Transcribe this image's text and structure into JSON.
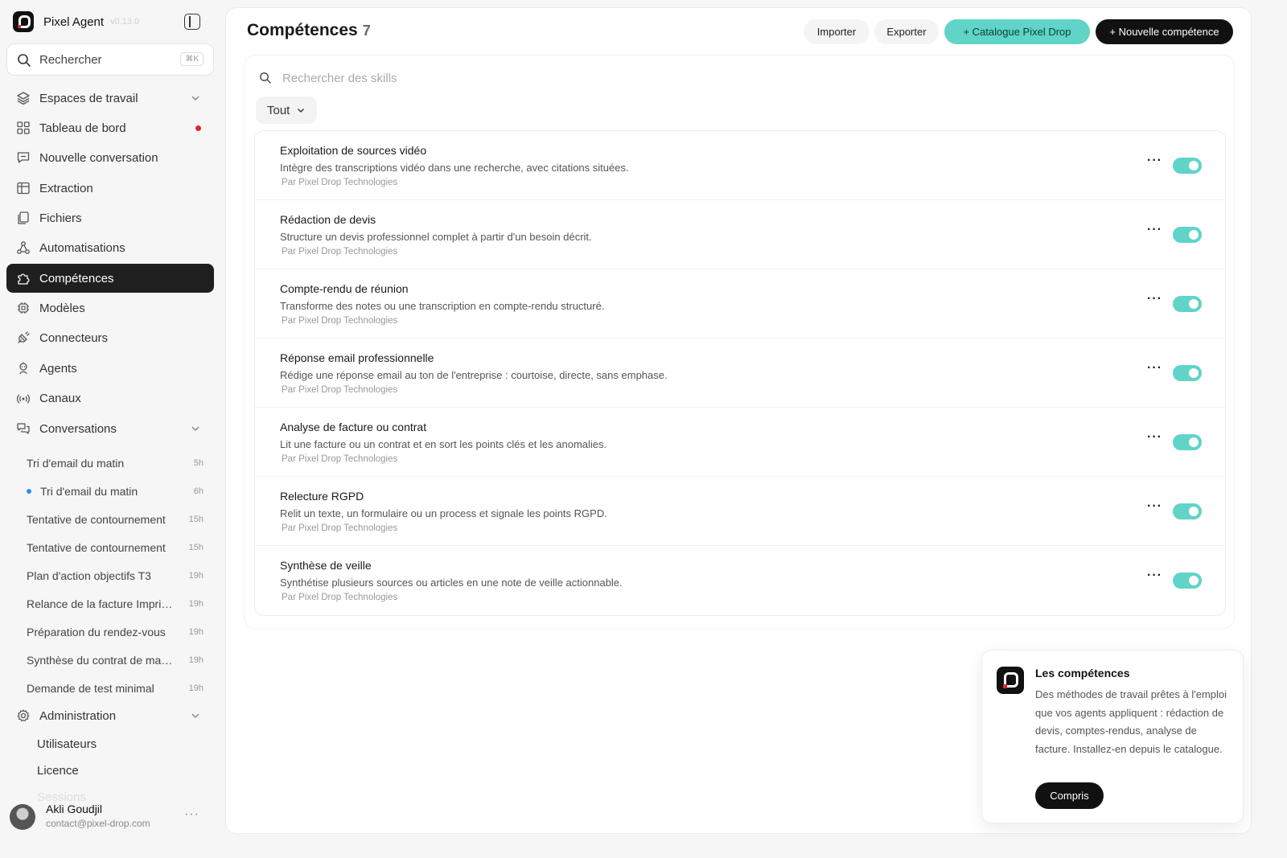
{
  "app": {
    "name": "Pixel Agent",
    "version": "v0.13.0"
  },
  "search": {
    "label": "Rechercher",
    "shortcut": "⌘K"
  },
  "nav": [
    {
      "id": "workspaces",
      "label": "Espaces de travail",
      "icon": "layers-icon"
    },
    {
      "id": "dashboard",
      "label": "Tableau de bord",
      "icon": "grid-icon"
    },
    {
      "id": "new-conversation",
      "label": "Nouvelle conversation",
      "icon": "message-plus-icon"
    },
    {
      "id": "extraction",
      "label": "Extraction",
      "icon": "table-icon"
    },
    {
      "id": "files",
      "label": "Fichiers",
      "icon": "files-icon"
    },
    {
      "id": "automations",
      "label": "Automatisations",
      "icon": "workflow-icon"
    },
    {
      "id": "skills",
      "label": "Compétences",
      "icon": "puzzle-icon",
      "active": true
    },
    {
      "id": "models",
      "label": "Modèles",
      "icon": "chip-icon"
    },
    {
      "id": "connectors",
      "label": "Connecteurs",
      "icon": "plug-icon"
    },
    {
      "id": "agents",
      "label": "Agents",
      "icon": "bot-icon"
    },
    {
      "id": "channels",
      "label": "Canaux",
      "icon": "radio-icon"
    },
    {
      "id": "conversations",
      "label": "Conversations",
      "icon": "chats-icon"
    }
  ],
  "conversations": [
    {
      "title": "Tri d'email du matin",
      "time": "5h"
    },
    {
      "title": "Tri d'email du matin",
      "time": "6h",
      "unread": true
    },
    {
      "title": "Tentative de contournement",
      "time": "15h"
    },
    {
      "title": "Tentative de contournement",
      "time": "15h"
    },
    {
      "title": "Plan d'action objectifs T3",
      "time": "19h"
    },
    {
      "title": "Relance de la facture Imprimerie",
      "time": "19h"
    },
    {
      "title": "Préparation du rendez-vous",
      "time": "19h"
    },
    {
      "title": "Synthèse du contrat de maintenance",
      "time": "19h"
    },
    {
      "title": "Demande de test minimal",
      "time": "19h"
    }
  ],
  "admin": {
    "label": "Administration",
    "items": [
      "Utilisateurs",
      "Licence",
      "Sessions"
    ]
  },
  "user": {
    "name": "Akli Goudjil",
    "email": "contact@pixel-drop.com"
  },
  "page": {
    "title": "Compétences",
    "count": "7",
    "actions": {
      "import": "Importer",
      "export": "Exporter",
      "catalog": "+ Catalogue Pixel Drop",
      "new": "+ Nouvelle compétence"
    },
    "search_placeholder": "Rechercher des skills",
    "filter": "Tout"
  },
  "skills": [
    {
      "name": "Exploitation de sources vidéo",
      "description": "Intègre des transcriptions vidéo dans une recherche, avec citations situées.",
      "author": "Par Pixel Drop Technologies",
      "enabled": true
    },
    {
      "name": "Rédaction de devis",
      "description": "Structure un devis professionnel complet à partir d'un besoin décrit.",
      "author": "Par Pixel Drop Technologies",
      "enabled": true
    },
    {
      "name": "Compte-rendu de réunion",
      "description": "Transforme des notes ou une transcription en compte-rendu structuré.",
      "author": "Par Pixel Drop Technologies",
      "enabled": true
    },
    {
      "name": "Réponse email professionnelle",
      "description": "Rédige une réponse email au ton de l'entreprise : courtoise, directe, sans emphase.",
      "author": "Par Pixel Drop Technologies",
      "enabled": true
    },
    {
      "name": "Analyse de facture ou contrat",
      "description": "Lit une facture ou un contrat et en sort les points clés et les anomalies.",
      "author": "Par Pixel Drop Technologies",
      "enabled": true
    },
    {
      "name": "Relecture RGPD",
      "description": "Relit un texte, un formulaire ou un process et signale les points RGPD.",
      "author": "Par Pixel Drop Technologies",
      "enabled": true
    },
    {
      "name": "Synthèse de veille",
      "description": "Synthétise plusieurs sources ou articles en une note de veille actionnable.",
      "author": "Par Pixel Drop Technologies",
      "enabled": true
    }
  ],
  "tip": {
    "title": "Les compétences",
    "body": "Des méthodes de travail prêtes à l'emploi que vos agents appliquent : rédaction de devis, comptes-rendus, analyse de facture. Installez-en depuis le catalogue.",
    "button": "Compris"
  },
  "colors": {
    "accent": "#5fd4c7",
    "dark": "#111111",
    "alert": "#e5232f",
    "unread": "#2d8cf0"
  }
}
